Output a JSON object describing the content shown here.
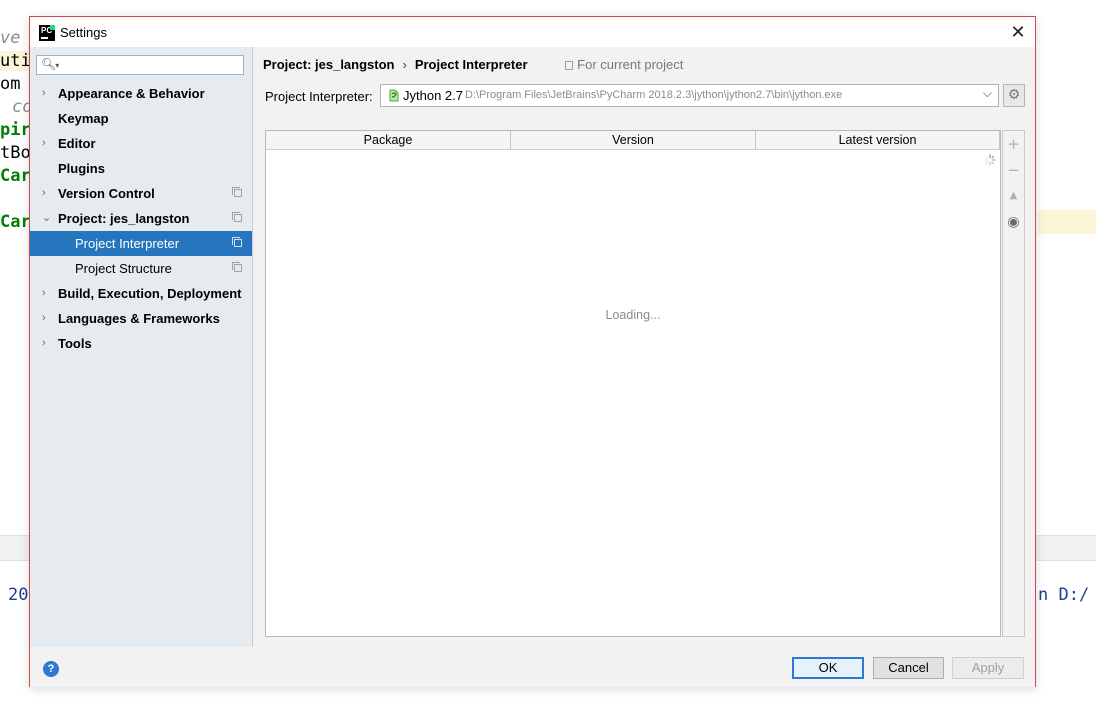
{
  "background_editor": {
    "lines": [
      "ve",
      "uti",
      "om",
      "co",
      "pir",
      "tBo",
      "Car",
      "Car"
    ],
    "bottom_left": "20",
    "bottom_right": "n D:/"
  },
  "dialog": {
    "title": "Settings",
    "close_glyph": "✕"
  },
  "sidebar": {
    "search": {
      "placeholder": "",
      "value": ""
    },
    "items": [
      {
        "label": "Appearance & Behavior",
        "expandable": true
      },
      {
        "label": "Keymap",
        "expandable": false
      },
      {
        "label": "Editor",
        "expandable": true
      },
      {
        "label": "Plugins",
        "expandable": false
      },
      {
        "label": "Version Control",
        "expandable": true
      },
      {
        "label": "Project: jes_langston",
        "expandable": true
      },
      {
        "label": "Project Interpreter",
        "selected": true
      },
      {
        "label": "Project Structure"
      },
      {
        "label": "Build, Execution, Deployment",
        "expandable": true
      },
      {
        "label": "Languages & Frameworks",
        "expandable": true
      },
      {
        "label": "Tools",
        "expandable": true
      }
    ]
  },
  "breadcrumb": {
    "project": "Project: jes_langston",
    "separator": "›",
    "page": "Project Interpreter",
    "scope": "For current project"
  },
  "interpreter": {
    "label": "Project Interpreter:",
    "name": "Jython 2.7",
    "path": "D:\\Program Files\\JetBrains\\PyCharm 2018.2.3\\jython\\jython2.7\\bin\\jython.exe",
    "dropdown_glyph": "⌵",
    "gear_glyph": "⚙"
  },
  "packages": {
    "columns": [
      "Package",
      "Version",
      "Latest version"
    ],
    "status": "Loading...",
    "tools": {
      "add": "+",
      "remove": "−",
      "upgrade": "▲",
      "show": "◉"
    }
  },
  "footer": {
    "help": "?",
    "ok": "OK",
    "cancel": "Cancel",
    "apply": "Apply"
  },
  "colors": {
    "selection": "#2675bf",
    "dialog_border": "#c94b4b",
    "accent": "#2b79d0"
  }
}
